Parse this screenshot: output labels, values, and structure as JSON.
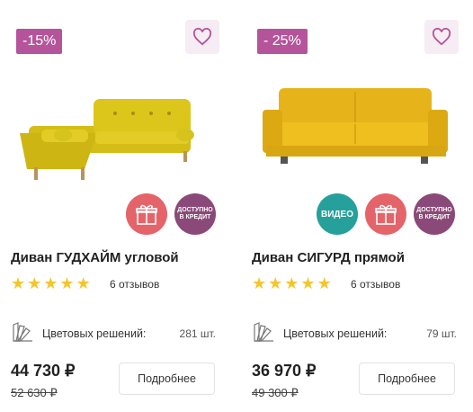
{
  "products": [
    {
      "discount": "-15%",
      "title": "Диван ГУДХАЙМ угловой",
      "rating": 5,
      "reviews": "6 отзывов",
      "colors_label": "Цветовых решений:",
      "colors_count": "281 шт.",
      "price": "44 730 ₽",
      "old_price": "52 630 ₽",
      "details_button": "Подробнее",
      "badges": [
        "gift",
        "credit"
      ],
      "credit_badge_text": [
        "ДОСТУПНО",
        "В КРЕДИТ"
      ],
      "sofa_color": "#dcc61c"
    },
    {
      "discount": "- 25%",
      "title": "Диван СИГУРД прямой",
      "rating": 5,
      "reviews": "6 отзывов",
      "colors_label": "Цветовых решений:",
      "colors_count": "79 шт.",
      "price": "36 970 ₽",
      "old_price": "49 300 ₽",
      "details_button": "Подробнее",
      "badges": [
        "video",
        "gift",
        "credit"
      ],
      "video_badge_text": "ВИДЕО",
      "credit_badge_text": [
        "ДОСТУПНО",
        "В КРЕДИТ"
      ],
      "sofa_color": "#eab81c"
    }
  ],
  "colors": {
    "discount_bg": "#b5549a",
    "favorite_bg": "#f6ecf4",
    "gift_badge": "#e4646a",
    "credit_badge": "#8a4978",
    "video_badge": "#26a09a",
    "star": "#f4c628"
  },
  "icons": {
    "favorite": "heart-icon",
    "gift": "gift-icon",
    "colors": "palette-icon",
    "rating": "star-icon"
  }
}
